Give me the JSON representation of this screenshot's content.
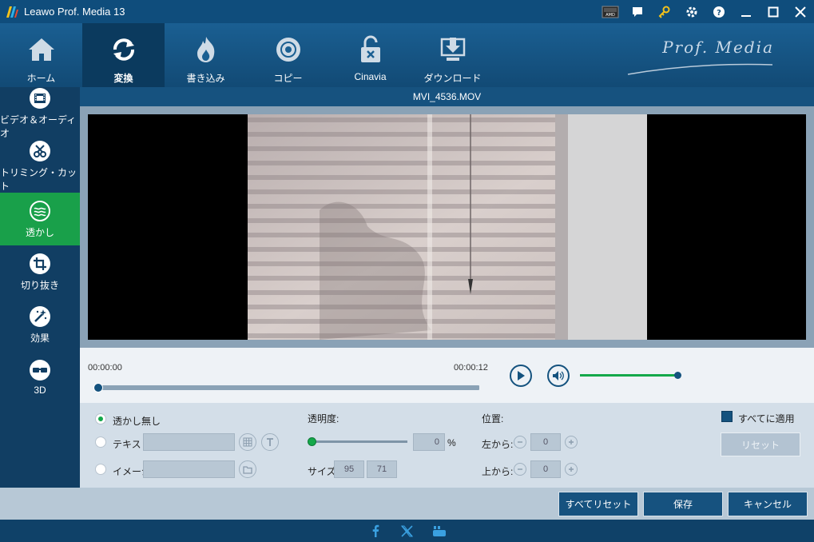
{
  "window": {
    "title": "Leawo Prof. Media 13"
  },
  "nav": {
    "items": [
      {
        "label": "ホーム",
        "icon": "home-icon"
      },
      {
        "label": "変換",
        "icon": "convert-icon",
        "active": true
      },
      {
        "label": "書き込み",
        "icon": "burn-icon"
      },
      {
        "label": "コピー",
        "icon": "disc-copy-icon"
      },
      {
        "label": "Cinavia",
        "icon": "unlock-icon"
      },
      {
        "label": "ダウンロード",
        "icon": "download-icon"
      }
    ],
    "brand": "Prof. Media"
  },
  "sidebar": {
    "items": [
      {
        "label": "ビデオ＆オーディオ",
        "icon": "film-icon"
      },
      {
        "label": "トリミング・カット",
        "icon": "scissors-icon"
      },
      {
        "label": "透かし",
        "icon": "watermark-icon",
        "active": true
      },
      {
        "label": "切り抜き",
        "icon": "crop-icon"
      },
      {
        "label": "効果",
        "icon": "effect-icon"
      },
      {
        "label": "3D",
        "icon": "3d-glasses-icon"
      }
    ]
  },
  "file": {
    "name": "MVI_4536.MOV"
  },
  "player": {
    "time_start": "00:00:00",
    "time_end": "00:00:12",
    "seek_fraction": 0.0,
    "volume_fraction": 1.0
  },
  "watermark": {
    "none_label": "透かし無し",
    "text_label": "テキスト",
    "image_label": "イメージ",
    "selected": "none",
    "opacity_label": "透明度:",
    "opacity_value": "0",
    "opacity_unit": "%",
    "size_label": "サイズ:",
    "size_w": "95",
    "size_h": "71",
    "position_label": "位置:",
    "from_left_label": "左から:",
    "from_left_value": "0",
    "from_top_label": "上から:",
    "from_top_value": "0",
    "apply_all_label": "すべてに適用",
    "apply_all_checked": true,
    "reset_label": "リセット"
  },
  "actions": {
    "reset_all": "すべてリセット",
    "save": "保存",
    "cancel": "キャンセル"
  },
  "colors": {
    "accent_green": "#19a04a",
    "primary_blue": "#16527f"
  }
}
